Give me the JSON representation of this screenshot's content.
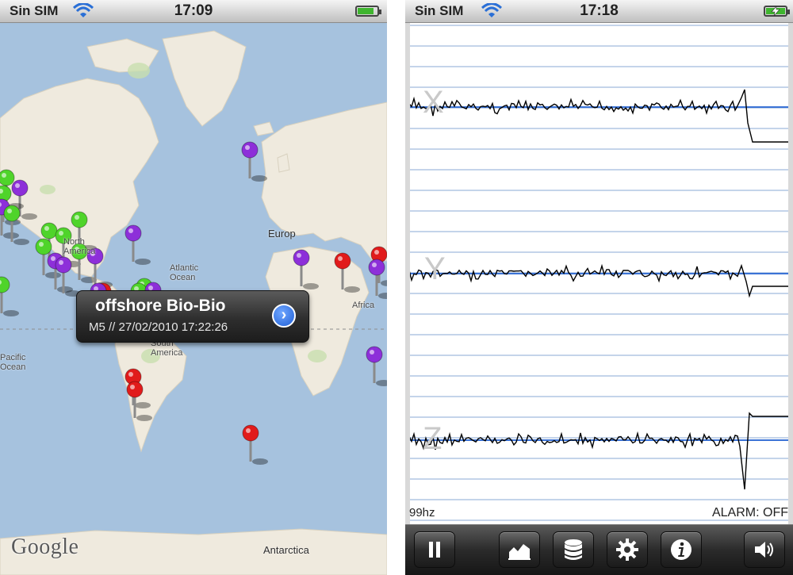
{
  "left_screen": {
    "status": {
      "carrier": "Sin SIM",
      "time": "17:09",
      "battery_level": 0.85,
      "battery_color": "#3fb52f"
    },
    "map": {
      "callout": {
        "title": "offshore Bio-Bio",
        "subtitle": "M5 // 27/02/2010 17:22:26",
        "detail_icon": "chevron-right-icon"
      },
      "labels": {
        "europe": "Europ",
        "africa": "Africa",
        "north_america": "North America",
        "atlantic": "Atlantic Ocean",
        "south_america": "South America",
        "pacific": "Pacific Ocean",
        "antarctica": "Antarctica"
      },
      "attribution": "Google",
      "pin_colors": {
        "purple": "#8d2fd9",
        "green": "#4fd42a",
        "red": "#e11b1b"
      }
    }
  },
  "right_screen": {
    "status": {
      "carrier": "Sin SIM",
      "time": "17:18",
      "battery_charging": true,
      "battery_color": "#3fb52f"
    },
    "seismograph": {
      "axes": [
        "X",
        "Y",
        "Z"
      ],
      "sample_rate": "99hz",
      "alarm": "ALARM: OFF",
      "grid_color": "#8aa9d6",
      "baseline_color": "#3b73d6",
      "trace_color": "#000000"
    },
    "toolbar": {
      "buttons": [
        {
          "name": "pause",
          "icon": "pause-icon"
        },
        {
          "name": "graph",
          "icon": "area-chart-icon"
        },
        {
          "name": "database",
          "icon": "database-icon"
        },
        {
          "name": "settings",
          "icon": "gear-icon"
        },
        {
          "name": "info",
          "icon": "info-icon"
        },
        {
          "name": "volume",
          "icon": "speaker-icon"
        }
      ]
    }
  }
}
